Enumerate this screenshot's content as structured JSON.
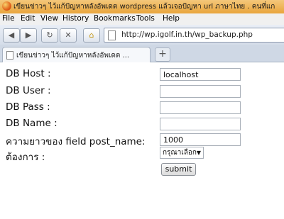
{
  "window": {
    "title": "เขียนข่าวๆ ไว้แก้ปัญหาหลังอัพเดต wordpress แล้วเจอปัญหา url ภาษาไทย . คนที่แก"
  },
  "menu": [
    "File",
    "Edit",
    "View",
    "History",
    "Bookmarks",
    "Tools",
    "Help"
  ],
  "nav": {
    "back_icon": "arrow-left-icon",
    "forward_icon": "arrow-right-icon",
    "url": "http://wp.igolf.in.th/wp_backup.php"
  },
  "tab": {
    "title": "เขียนข่าวๆ ไว้แก้ปัญหาหลังอัพเดต ...",
    "close": "×",
    "new_tab": "+"
  },
  "form": {
    "fields": [
      {
        "label": "DB Host :",
        "value": ""
      },
      {
        "label": "DB User :",
        "value": ""
      },
      {
        "label": "DB Pass :",
        "value": ""
      },
      {
        "label": "DB Name :",
        "value": ""
      },
      {
        "label": "ความยาวของ field post_name:",
        "value": "1000"
      }
    ],
    "host_value": "localhost",
    "action_label": "ต้องการ :",
    "action_selected": "กรุณาเลือก",
    "submit_label": "submit"
  }
}
